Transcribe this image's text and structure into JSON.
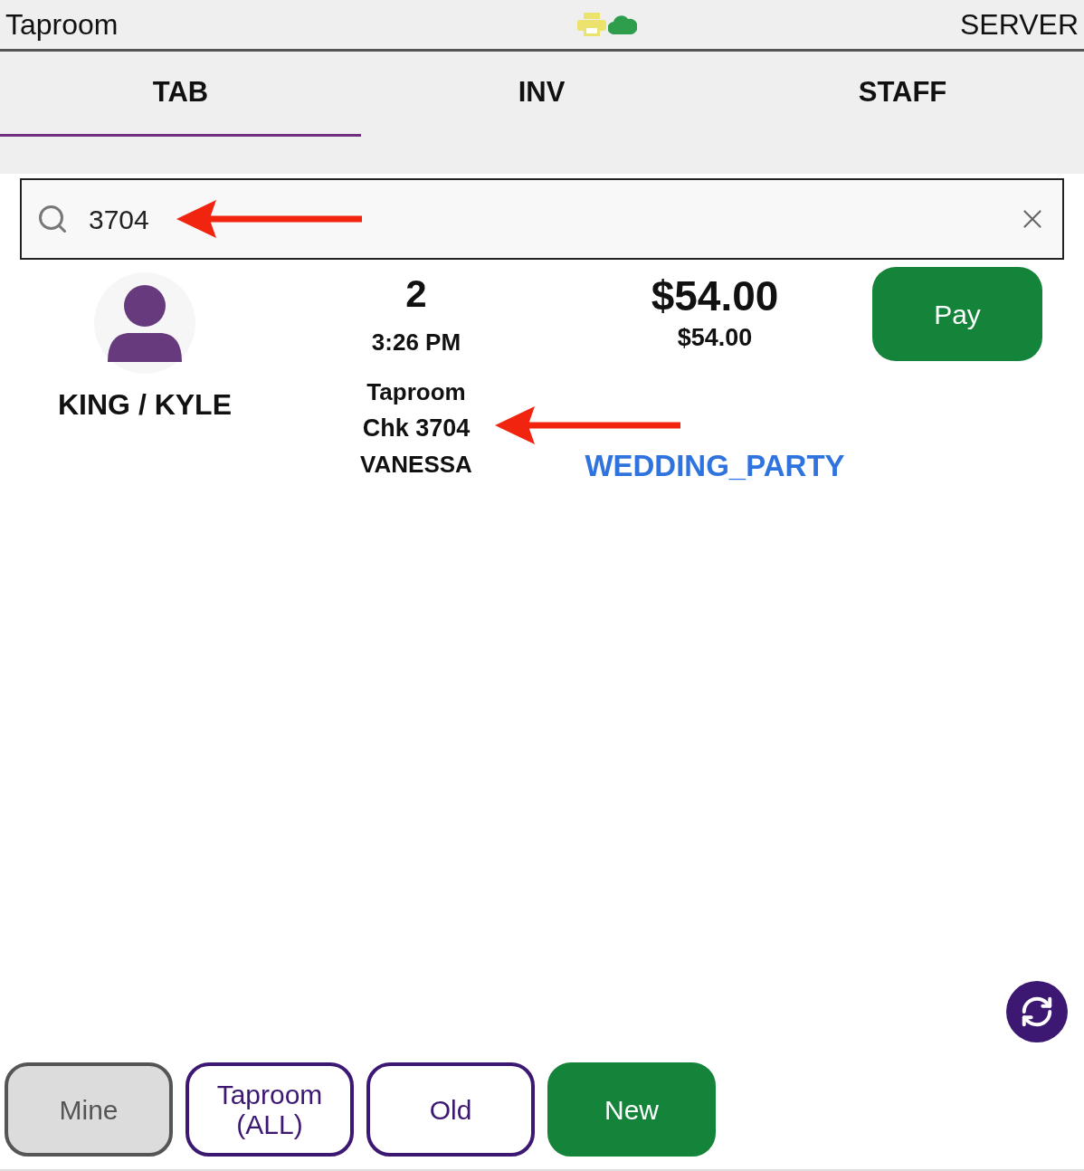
{
  "header": {
    "title": "Taproom",
    "role": "SERVER"
  },
  "tabs": [
    {
      "label": "TAB",
      "selected": true
    },
    {
      "label": "INV",
      "selected": false
    },
    {
      "label": "STAFF",
      "selected": false
    }
  ],
  "search": {
    "value": "3704"
  },
  "tab_row": {
    "name": "KING / KYLE",
    "guests": "2",
    "time": "3:26 PM",
    "location": "Taproom",
    "check": "Chk 3704",
    "server": "VANESSA",
    "total": "$54.00",
    "subtotal": "$54.00",
    "tag": "WEDDING_PARTY",
    "pay_button": "Pay"
  },
  "filters": [
    {
      "label": "Mine",
      "kind": "filter",
      "selected": true
    },
    {
      "label": "Taproom (ALL)",
      "kind": "filter",
      "selected": false
    },
    {
      "label": "Old",
      "kind": "filter",
      "selected": false
    },
    {
      "label": "New",
      "kind": "action",
      "selected": false
    }
  ]
}
